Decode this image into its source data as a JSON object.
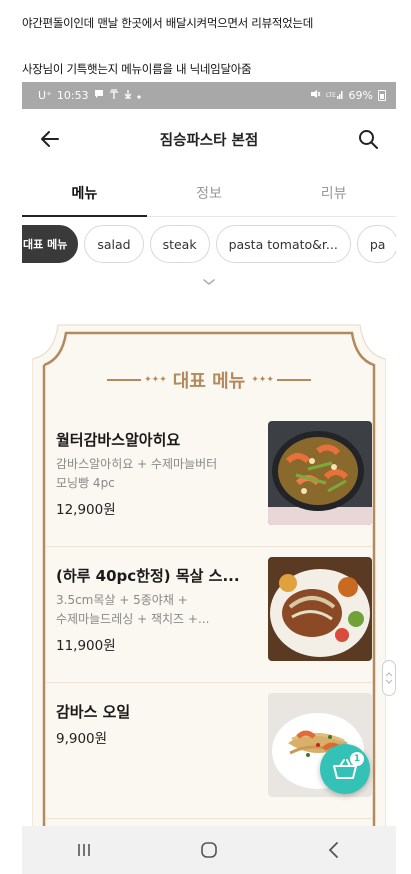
{
  "caption": {
    "line1": "야간편돌이인데 맨날 한곳에서 배달시켜먹으면서 리뷰적었는데",
    "line2": "사장님이 기특햇는지 메뉴이름을 내 닉네임달아줌"
  },
  "status_bar": {
    "carrier": "U⁺",
    "time": "10:53",
    "battery": "69%"
  },
  "app_bar": {
    "title": "짐승파스타 본점",
    "back_icon": "arrow-left-icon",
    "search_icon": "search-icon"
  },
  "tabs": [
    {
      "label": "메뉴",
      "active": true
    },
    {
      "label": "정보",
      "active": false
    },
    {
      "label": "리뷰",
      "active": false
    }
  ],
  "chips": [
    {
      "label": "대표 메뉴",
      "active": true
    },
    {
      "label": "salad",
      "active": false
    },
    {
      "label": "steak",
      "active": false
    },
    {
      "label": "pasta tomato&r...",
      "active": false
    },
    {
      "label": "pa",
      "active": false
    }
  ],
  "section": {
    "title": "대표 메뉴",
    "accent_color": "#b38a5e"
  },
  "menu_items": [
    {
      "name": "월터감바스알아히요",
      "desc_line1": "감바스알아히요 + 수제마늘버터",
      "desc_line2": "모닝빵 4pc",
      "price": "12,900원"
    },
    {
      "name": "(하루 40pc한정) 목살 스...",
      "desc_line1": "3.5cm목살 + 5종야채 +",
      "desc_line2": "수제마늘드레싱 + 잭치즈 +...",
      "price": "11,900원"
    },
    {
      "name": "감바스 오일",
      "desc_line1": "",
      "desc_line2": "",
      "price": "9,900원"
    }
  ],
  "cart": {
    "count": "1",
    "color": "#35c2b6"
  },
  "nav_bar": {
    "recent_icon": "recent-apps-icon",
    "home_icon": "home-icon",
    "back_icon": "nav-back-icon"
  }
}
